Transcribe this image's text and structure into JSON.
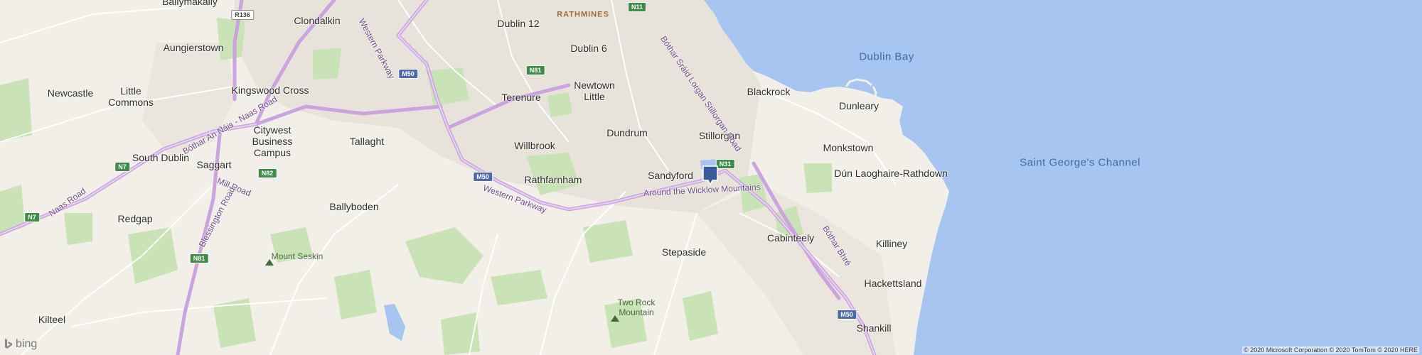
{
  "map": {
    "colors": {
      "land": "#f2efe9",
      "sea": "#a7c5f1",
      "park": "#c7e0b3",
      "urban": "#e6e1d8",
      "motorway": "#c8a2e0",
      "road": "#ffffff",
      "marker": "#3b5a9a"
    },
    "water_labels": {
      "dublin_bay": "Dublin Bay",
      "saint_georges": "Saint George's Channel"
    },
    "district_labels": {
      "rathmines": "RATHMINES"
    },
    "towns": {
      "ballymakally": "Ballymakally",
      "clondalkin": "Clondalkin",
      "dublin12": "Dublin 12",
      "dublin6": "Dublin 6",
      "aungierstown": "Aungierstown",
      "newcastle": "Newcastle",
      "little_commons": "Little\nCommons",
      "kingswood": "Kingswood Cross",
      "citywest": "Citywest\nBusiness\nCampus",
      "terenure": "Terenure",
      "newtown_little": "Newtown\nLittle",
      "blackrock": "Blackrock",
      "dunleary": "Dunleary",
      "tallaght": "Tallaght",
      "willbrook": "Willbrook",
      "dundrum": "Dundrum",
      "stillorgan": "Stillorgan",
      "monkstown": "Monkstown",
      "south_dublin": "South Dublin",
      "saggart": "Saggart",
      "rathfarnham": "Rathfarnham",
      "sandyford": "Sandyford",
      "dun_laoghaire": "Dún Laoghaire-Rathdown",
      "ballyboden": "Ballyboden",
      "redgap": "Redgap",
      "cabinteely": "Cabinteely",
      "stepaside": "Stepaside",
      "killiney": "Killiney",
      "hackettsland": "Hackettsland",
      "kilteel": "Kilteel",
      "shankill": "Shankill"
    },
    "peaks": {
      "mount_seskin": "Mount Seskin",
      "two_rock": "Two Rock\nMountain"
    },
    "roads": {
      "western_parkway_n": "Western Parkway",
      "western_parkway_s": "Western Parkway",
      "bothar_sraid": "Bóthar Sráid Lorgan Stillorgan Road",
      "bothar_nais": "Bóthar An Náis - Naas Road",
      "mill_road": "Mill Road",
      "naas_road": "Naas Road",
      "blessington": "Blessington Road",
      "around_wicklow": "Around the Wicklow Mountains",
      "bothar_bhre": "Bóthar Bhré"
    },
    "shields": {
      "r136": "R136",
      "n11": "N11",
      "m50_a": "M50",
      "n81_a": "N81",
      "n7_a": "N7",
      "n82": "N82",
      "m50_b": "M50",
      "n31": "N31",
      "n7_b": "N7",
      "n81_b": "N81",
      "m50_c": "M50"
    },
    "logo": {
      "text": "bing",
      "icon": "bing-logo-icon"
    },
    "attribution": "© 2020 Microsoft Corporation © 2020 TomTom © 2020 HERE"
  }
}
